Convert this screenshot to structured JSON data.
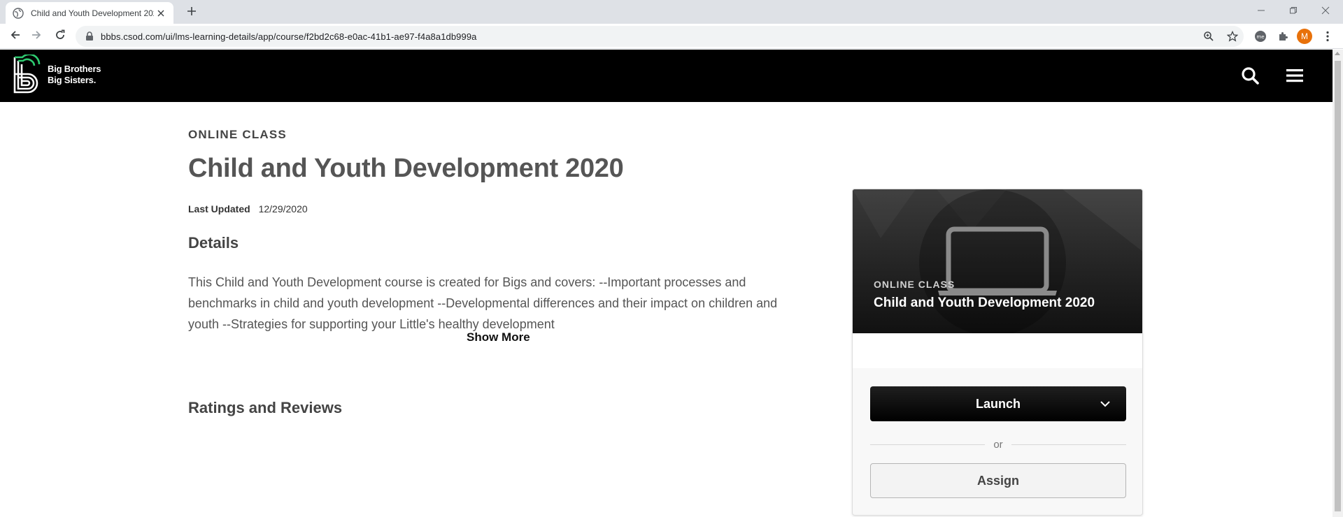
{
  "browser": {
    "tab_title": "Child and Youth Development 2020",
    "url": "bbbs.csod.com/ui/lms-learning-details/app/course/f2bd2c68-e0ac-41b1-ae97-f4a8a1db999a",
    "avatar_letter": "M",
    "icons": [
      "globe-icon",
      "close-icon",
      "plus-icon",
      "back-icon",
      "forward-icon",
      "reload-icon",
      "lock-icon",
      "zoom-icon",
      "star-icon",
      "extension-icon",
      "puzzle-icon",
      "menu-dots-icon"
    ]
  },
  "header": {
    "brand_line1": "Big Brothers",
    "brand_line2": "Big Sisters.",
    "accent_color": "#2ecc71"
  },
  "course": {
    "eyebrow": "ONLINE CLASS",
    "title": "Child and Youth Development 2020",
    "updated_label": "Last Updated",
    "updated_value": "12/29/2020",
    "details_heading": "Details",
    "description": "This Child and Youth Development course is created for Bigs and covers: --Important processes and benchmarks in child and youth development --Developmental differences and their impact on children and youth --Strategies for supporting your Little's healthy development",
    "show_more": "Show More",
    "ratings_heading": "Ratings and Reviews"
  },
  "card": {
    "eyebrow": "ONLINE CLASS",
    "title": "Child and Youth Development 2020",
    "launch_label": "Launch",
    "or_label": "or",
    "assign_label": "Assign"
  }
}
